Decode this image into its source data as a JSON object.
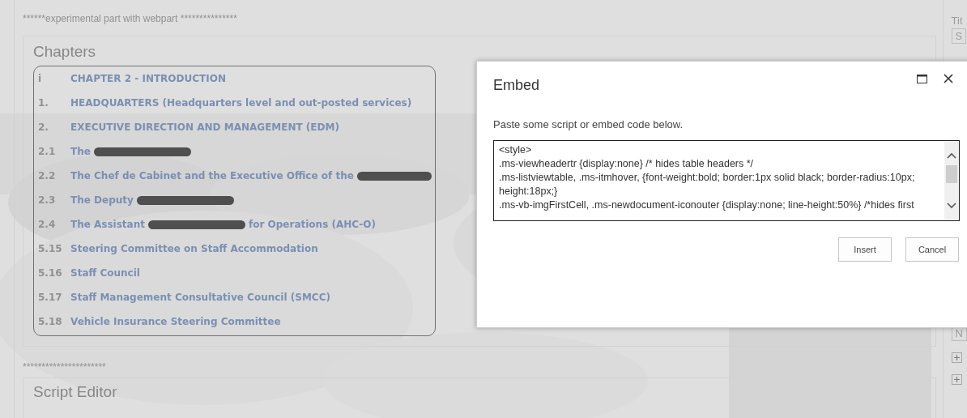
{
  "page_note": "******experimental part with webpart  ***************",
  "chapters": {
    "title": "Chapters",
    "rows": [
      {
        "number": "i",
        "title": "CHAPTER 2 - INTRODUCTION",
        "redacted": false
      },
      {
        "number": "1.",
        "title": "HEADQUARTERS (Headquarters level and out-posted services)",
        "redacted": false
      },
      {
        "number": "2.",
        "title": "EXECUTIVE DIRECTION AND MANAGEMENT (EDM)",
        "redacted": false
      },
      {
        "number": "2.1",
        "title": "The",
        "redacted": true
      },
      {
        "number": "2.2",
        "title": "The Chef de Cabinet and the Executive Office of the",
        "redacted": true
      },
      {
        "number": "2.3",
        "title": "The Deputy",
        "redacted": true
      },
      {
        "number": "2.4",
        "title": "The Assistant",
        "redacted": true,
        "title_after": "for Operations (AHC-O)"
      },
      {
        "number": "5.15",
        "title": "Steering Committee on Staff Accommodation",
        "redacted": false
      },
      {
        "number": "5.16",
        "title": "Staff Council",
        "redacted": false
      },
      {
        "number": "5.17",
        "title": "Staff Management Consultative Council (SMCC)",
        "redacted": false
      },
      {
        "number": "5.18",
        "title": "Vehicle Insurance Steering Committee",
        "redacted": false
      }
    ]
  },
  "separator_note": "**********************",
  "script_editor": {
    "title": "Script Editor"
  },
  "side_panel": {
    "label": "Tit",
    "field_1": "S",
    "field_2": "N"
  },
  "dialog": {
    "title": "Embed",
    "instruction": "Paste some script or embed code below.",
    "code_lines": [
      "<style>",
      ".ms-viewheadertr {display:none} /* hides table headers */",
      ".ms-listviewtable, .ms-itmhover, {font-weight:bold; border:1px solid black; border-radius:10px; height:18px;}",
      ".ms-vb-imgFirstCell, .ms-newdocument-iconouter {display:none; line-height:50%} /*hides first"
    ],
    "buttons": [
      "Insert",
      "Cancel"
    ]
  }
}
